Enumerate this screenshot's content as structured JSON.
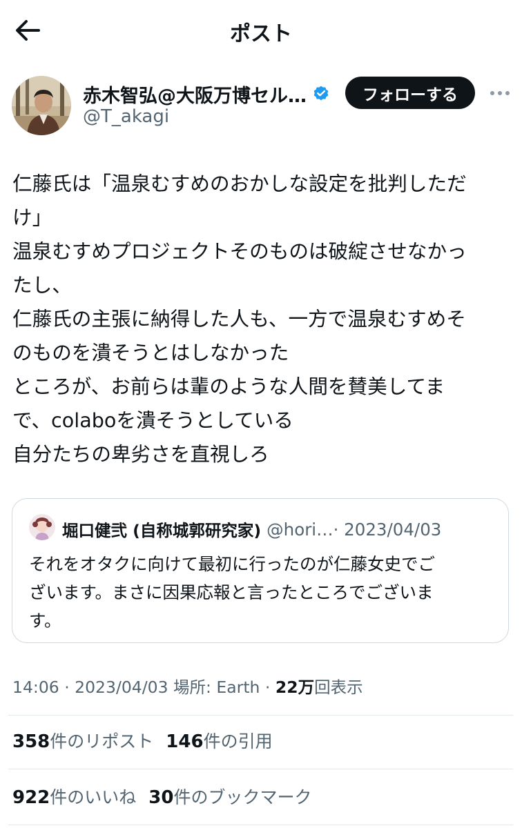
{
  "header": {
    "title": "ポスト"
  },
  "author": {
    "name": "赤木智弘@大阪万博セル…",
    "handle": "@T_akagi",
    "follow_label": "フォローする"
  },
  "post": {
    "lines": [
      "仁藤氏は「温泉むすめのおかしな設定を批判しただ",
      "け」",
      "温泉むすめプロジェクトそのものは破綻させなかっ",
      "たし、",
      "仁藤氏の主張に納得した人も、一方で温泉むすめそ",
      "のものを潰そうとはしなかった",
      "ところが、お前らは輩のような人間を賛美してま",
      "で、colaboを潰そうとしている",
      "自分たちの卑劣さを直視しろ"
    ]
  },
  "quote": {
    "name": "堀口健弐 (自称城郭研究家)",
    "handle": "@hori…",
    "date": " · 2023/04/03",
    "lines": [
      "それをオタクに向けて最初に行ったのが仁藤女史でご",
      "ざいます。まさに因果応報と言ったところでございま",
      "す。"
    ]
  },
  "meta": {
    "time_place": "14:06 · 2023/04/03 場所: Earth · ",
    "views_count": "22万",
    "views_label": "回表示"
  },
  "stats": {
    "reposts_count": "358",
    "reposts_label": "件のリポスト",
    "quotes_count": "146",
    "quotes_label": "件の引用",
    "likes_count": "922",
    "likes_label": "件のいいね",
    "bookmarks_count": "30",
    "bookmarks_label": "件のブックマーク"
  },
  "colors": {
    "verified": "#1d9bf0",
    "muted": "#536471",
    "text": "#0f1419",
    "follow_bg": "#0f1419"
  },
  "icons": [
    "back-arrow-icon",
    "verified-badge-icon",
    "more-icon"
  ]
}
